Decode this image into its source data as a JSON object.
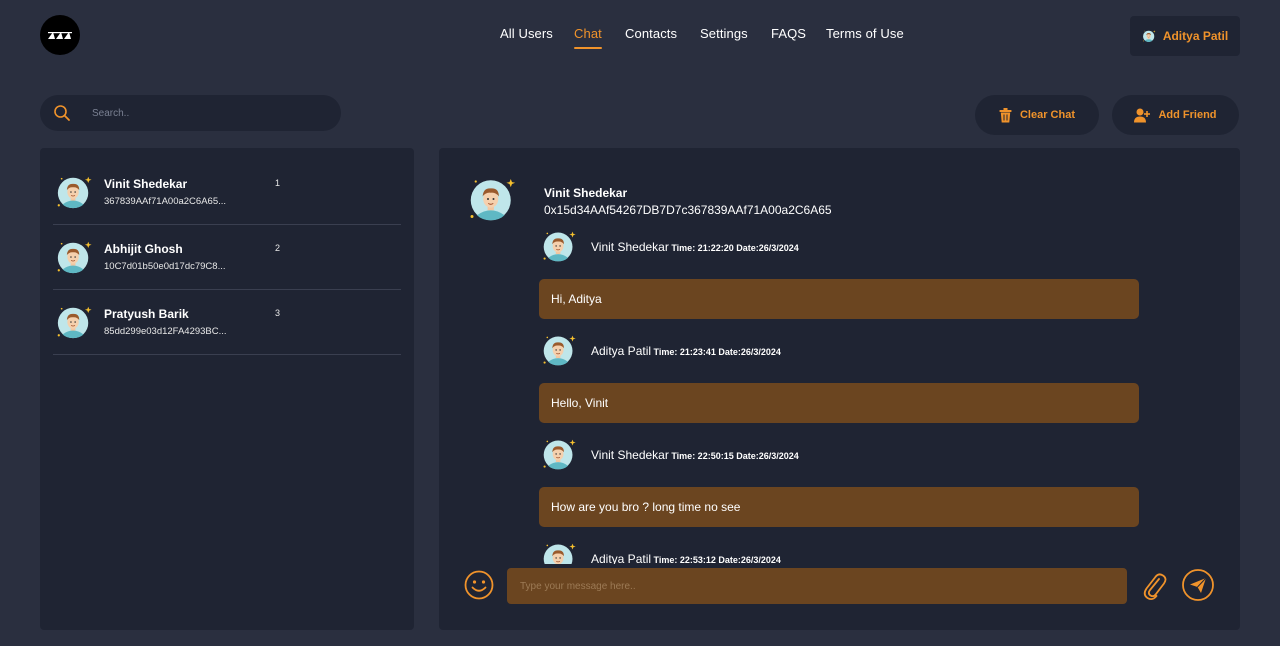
{
  "nav": {
    "items": [
      {
        "label": "All Users",
        "active": false
      },
      {
        "label": "Chat",
        "active": true
      },
      {
        "label": "Contacts",
        "active": false
      },
      {
        "label": "Settings",
        "active": false
      },
      {
        "label": "FAQS",
        "active": false
      },
      {
        "label": "Terms of Use",
        "active": false
      }
    ]
  },
  "user": {
    "name": "Aditya Patil"
  },
  "search": {
    "placeholder": "Search.."
  },
  "actions": {
    "clear_chat": "Clear Chat",
    "add_friend": "Add Friend"
  },
  "contacts": [
    {
      "name": "Vinit Shedekar",
      "address": "367839AAf71A00a2C6A65...",
      "index": "1"
    },
    {
      "name": "Abhijit Ghosh",
      "address": "10C7d01b50e0d17dc79C8...",
      "index": "2"
    },
    {
      "name": "Pratyush Barik",
      "address": "85dd299e03d12FA4293BC...",
      "index": "3"
    }
  ],
  "chat": {
    "name": "Vinit Shedekar",
    "address": "0x15d34AAf54267DB7D7c367839AAf71A00a2C6A65",
    "messages": [
      {
        "sender": "Vinit Shedekar",
        "time": " Time: 21:22:20 Date:26/3/2024",
        "text": "Hi, Aditya"
      },
      {
        "sender": "Aditya Patil",
        "time": " Time: 21:23:41 Date:26/3/2024",
        "text": "Hello, Vinit"
      },
      {
        "sender": "Vinit Shedekar",
        "time": " Time: 22:50:15 Date:26/3/2024",
        "text": "How are you bro ? long time no see"
      },
      {
        "sender": "Aditya Patil",
        "time": " Time: 22:53:12 Date:26/3/2024",
        "text": ""
      }
    ]
  },
  "composer": {
    "placeholder": "Type your message here.."
  },
  "colors": {
    "accent": "#f0932b",
    "background": "#2a2f3f",
    "panel": "#1f2433",
    "bubble": "#6b4520"
  }
}
